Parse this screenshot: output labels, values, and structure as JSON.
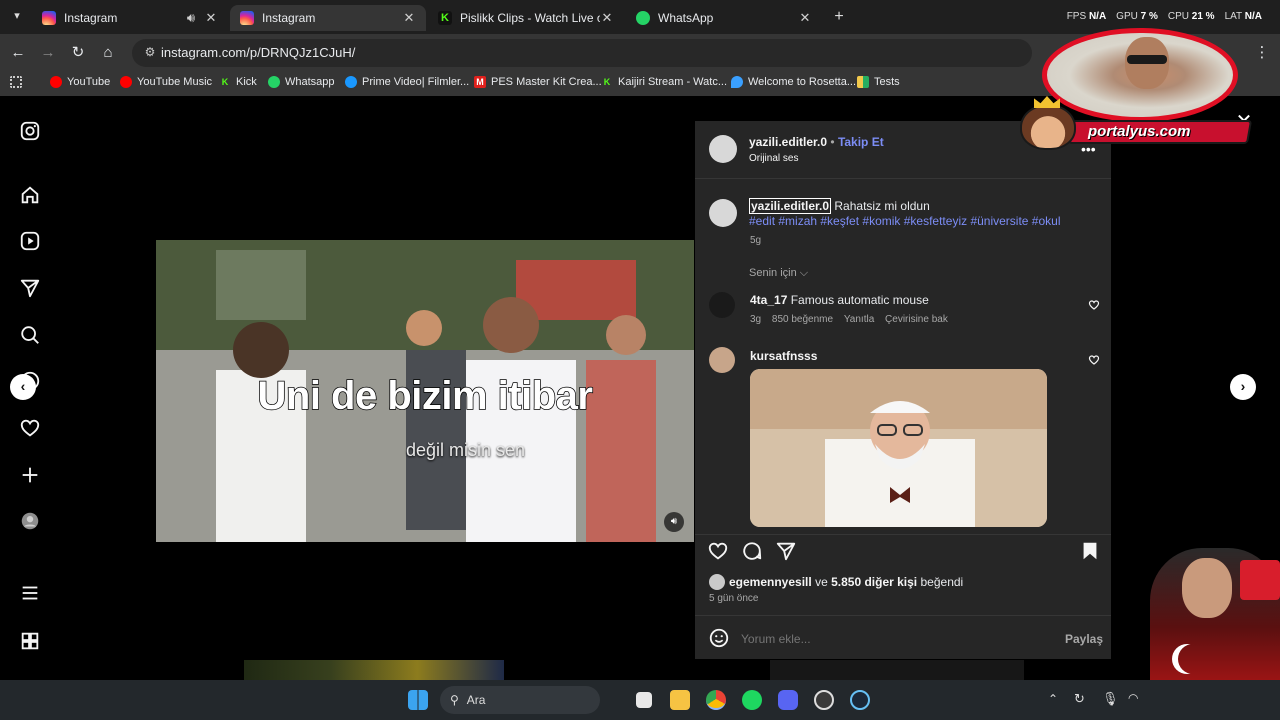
{
  "browser": {
    "tabs": [
      {
        "title": "Instagram",
        "favicon": "instagram-icon"
      },
      {
        "title": "Instagram",
        "favicon": "instagram-icon"
      },
      {
        "title": "Pislikk Clips - Watch Live on Kick",
        "favicon": "kick-icon"
      },
      {
        "title": "WhatsApp",
        "favicon": "whatsapp-icon"
      }
    ],
    "url": "instagram.com/p/DRNQJz1CJuH/",
    "stats": {
      "fps_label": "FPS",
      "fps_value": "N/A",
      "gpu_label": "GPU",
      "gpu_value": "7 %",
      "cpu_label": "CPU",
      "cpu_value": "21 %",
      "lat_label": "LAT",
      "lat_value": "N/A"
    },
    "bookmarks": [
      {
        "label": "YouTube",
        "icon": "youtube-icon",
        "color": "#ff0000"
      },
      {
        "label": "YouTube Music",
        "icon": "youtube-music-icon",
        "color": "#ff0000"
      },
      {
        "label": "Kick",
        "icon": "kick-icon",
        "color": "#53fc18"
      },
      {
        "label": "Whatsapp",
        "icon": "whatsapp-icon",
        "color": "#25d366"
      },
      {
        "label": "Prime Video| Filmler...",
        "icon": "prime-video-icon",
        "color": "#1a98ff"
      },
      {
        "label": "PES Master Kit Crea...",
        "icon": "pes-master-icon",
        "color": "#e0201c"
      },
      {
        "label": "Kaijiri Stream - Watc...",
        "icon": "kick-icon",
        "color": "#53fc18"
      },
      {
        "label": "Welcome to Rosetta...",
        "icon": "rosetta-icon",
        "color": "#3aa0ff"
      },
      {
        "label": "Tests",
        "icon": "tests-icon",
        "color": "#f2c94c"
      }
    ]
  },
  "video": {
    "caption_main": "Uni de bizim itibar",
    "caption_sub": "değil misin sen"
  },
  "post": {
    "author": "yazili.editler.0",
    "follow_label": "Takip Et",
    "audio": "Orijinal ses",
    "caption_user": "yazili.editler.0",
    "caption_text": "Rahatsiz mi oldun",
    "hashtags": "#edit #mizah #keşfet #komik #kesfetteyiz #üniversite #okul",
    "caption_age": "5g",
    "filter_label": "Senin için",
    "comments": [
      {
        "user": "4ta_17",
        "text": "Famous automatic mouse",
        "age": "3g",
        "likes": "850 beğenme",
        "reply": "Yanıtla",
        "translate": "Çevirisine bak"
      },
      {
        "user": "kursatfnsss",
        "text": ""
      }
    ],
    "liked_by_user": "egemennyesill",
    "liked_by_rest": "ve",
    "liked_by_count": "5.850 diğer kişi",
    "liked_by_suffix": "beğendi",
    "post_age": "5 gün önce",
    "comment_placeholder": "Yorum ekle...",
    "share_label": "Paylaş"
  },
  "overlay": {
    "brand": "portalyus.com"
  },
  "taskbar": {
    "search_label": "Ara"
  },
  "colors": {
    "instagram_link": "#7c8df5",
    "panel_bg": "#262626",
    "tab_bar": "#1f1f1f",
    "toolbar": "#353535"
  }
}
